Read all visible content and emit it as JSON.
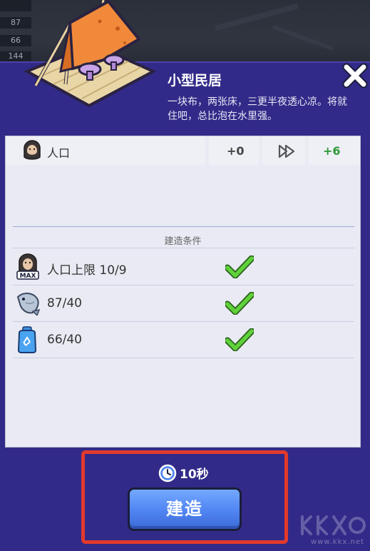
{
  "hud": {
    "stat_1": "87",
    "stat_2": "66",
    "stat_3": "144"
  },
  "building": {
    "name": "小型民居",
    "description": "一块布，两张床，三更半夜透心凉。将就住吧，总比泡在水里强。",
    "icon": "tent-icon"
  },
  "population": {
    "label": "人口",
    "current": "+0",
    "next": "+6",
    "icon": "caveman-icon"
  },
  "conditions_title": "建造条件",
  "requirements": [
    {
      "icon": "caveman-max-icon",
      "text": "人口上限 10/9",
      "met": true
    },
    {
      "icon": "fish-icon",
      "text": "87/40",
      "met": true
    },
    {
      "icon": "water-bottle-icon",
      "text": "66/40",
      "met": true
    }
  ],
  "timer": {
    "label": "10秒",
    "icon": "clock-icon"
  },
  "build_button": "建造",
  "watermark": {
    "text": "www.kkx.net"
  },
  "colors": {
    "dialog_bg": "#322a88",
    "panel_bg": "#e9eaf3",
    "button_blue": "#4f84f2",
    "check_green": "#4fc52d",
    "highlight_red": "#e2392c",
    "next_value_green": "#2f9a3a"
  }
}
